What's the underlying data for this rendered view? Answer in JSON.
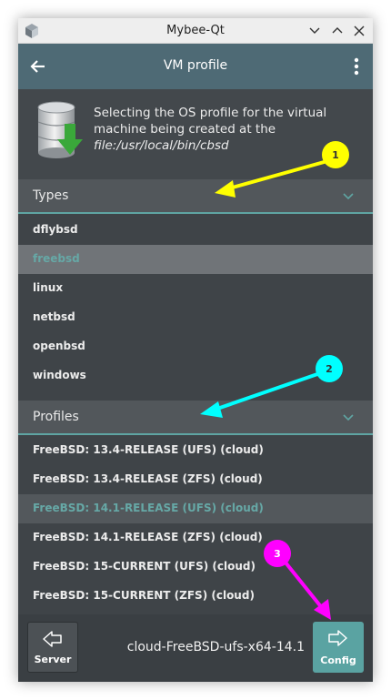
{
  "window": {
    "title": "Mybee-Qt",
    "controls": [
      "chevron-down-icon",
      "chevron-up-icon",
      "close-icon"
    ]
  },
  "appbar": {
    "title": "VM profile",
    "back_icon": "arrow-left-icon",
    "menu_icon": "more-vert-icon"
  },
  "info": {
    "text_prefix": "Selecting the OS profile for the virtual machine being created at the ",
    "path": "file:/usr/local/bin/cbsd",
    "icon": "database-download-icon"
  },
  "types": {
    "header": "Types",
    "items": [
      "dflybsd",
      "freebsd",
      "linux",
      "netbsd",
      "openbsd",
      "windows"
    ],
    "selected": "freebsd"
  },
  "profiles": {
    "header": "Profiles",
    "items": [
      "FreeBSD: 13.4-RELEASE (UFS) (cloud)",
      "FreeBSD: 13.4-RELEASE (ZFS) (cloud)",
      "FreeBSD: 14.1-RELEASE (UFS) (cloud)",
      "FreeBSD: 14.1-RELEASE (ZFS) (cloud)",
      "FreeBSD: 15-CURRENT (UFS) (cloud)",
      "FreeBSD: 15-CURRENT (ZFS) (cloud)"
    ],
    "selected": "FreeBSD: 14.1-RELEASE (UFS) (cloud)"
  },
  "bottom": {
    "server_label": "Server",
    "config_label": "Config",
    "profile_name": "cloud-FreeBSD-ufs-x64-14.1"
  },
  "annotations": [
    {
      "number": "1",
      "color": "#ffff00"
    },
    {
      "number": "2",
      "color": "#00ffff"
    },
    {
      "number": "3",
      "color": "#ff00ff"
    }
  ],
  "colors": {
    "accent": "#5aa3a2",
    "appbar": "#4e6a75",
    "background": "#3f4448"
  }
}
